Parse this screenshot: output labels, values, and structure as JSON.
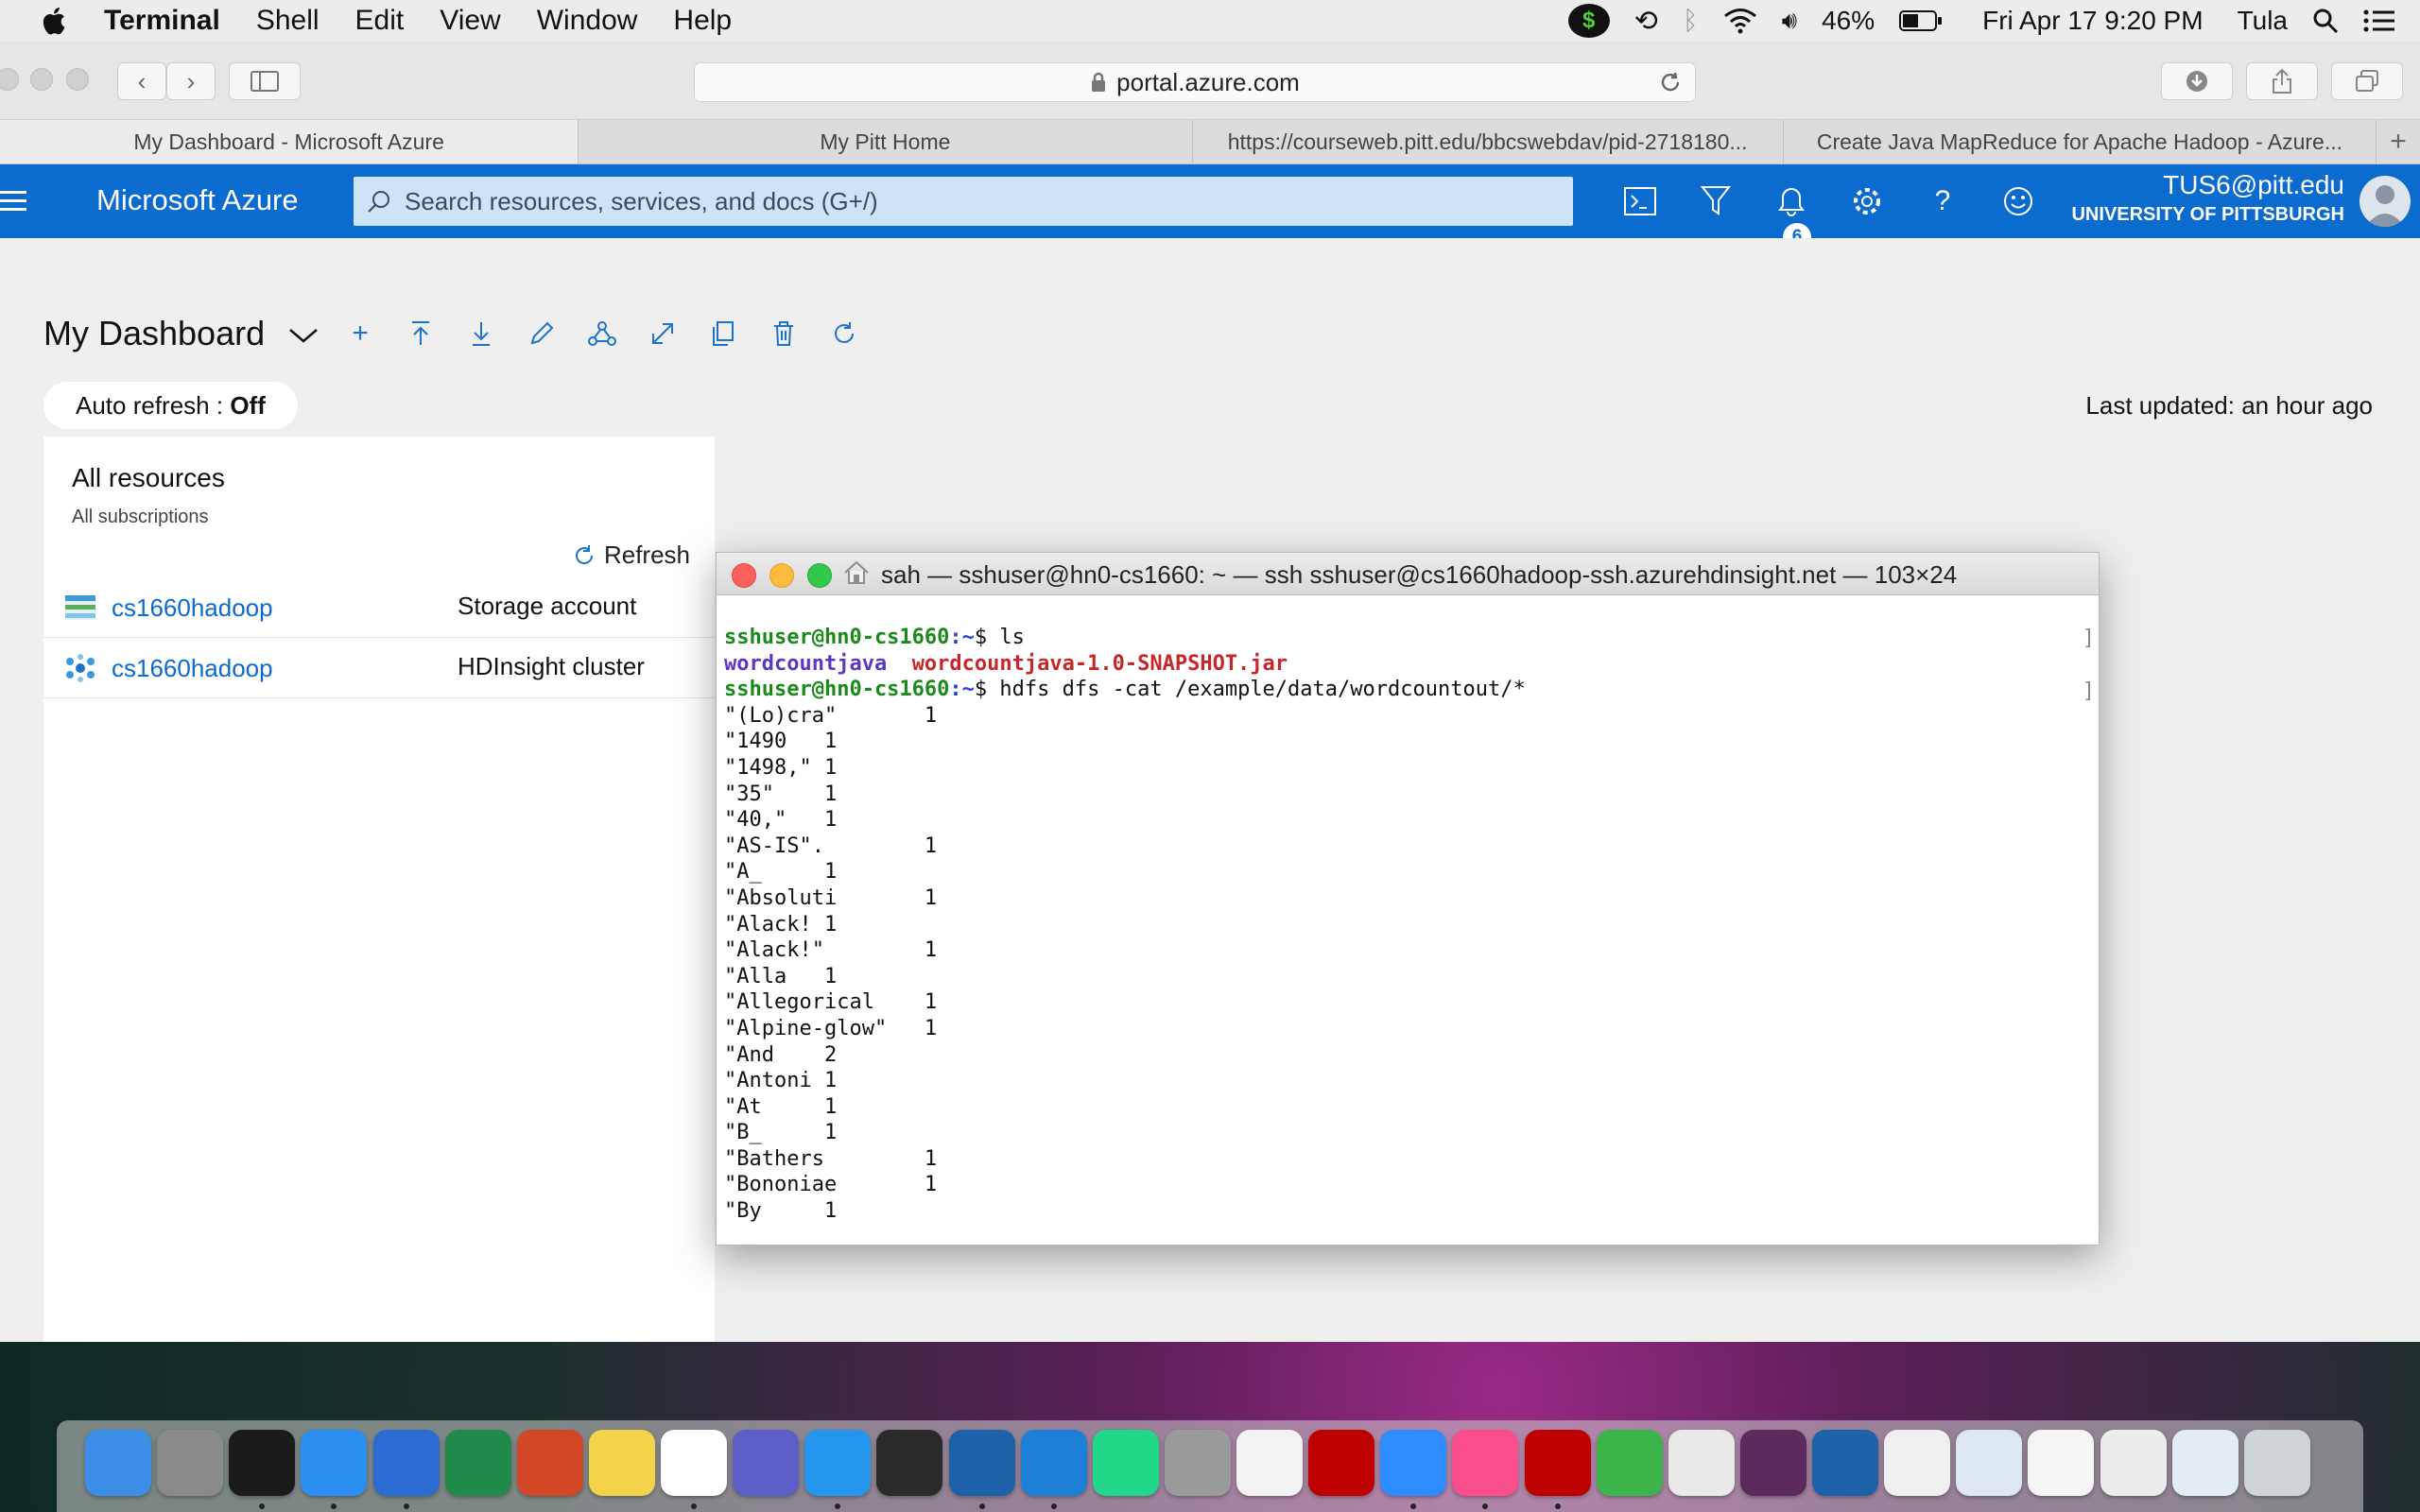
{
  "menubar": {
    "app": "Terminal",
    "items": [
      "Shell",
      "Edit",
      "View",
      "Window",
      "Help"
    ],
    "battery": "46%",
    "datetime": "Fri Apr 17  9:20 PM",
    "user": "Tula"
  },
  "browser": {
    "url": "portal.azure.com",
    "tabs": [
      "My Dashboard - Microsoft Azure",
      "My Pitt Home",
      "https://courseweb.pitt.edu/bbcswebdav/pid-2718180...",
      "Create Java MapReduce for Apache Hadoop - Azure..."
    ]
  },
  "azure": {
    "brand": "Microsoft Azure",
    "search_placeholder": "Search resources, services, and docs (G+/)",
    "notifications": "6",
    "account_email": "TUS6@pitt.edu",
    "account_org": "UNIVERSITY OF PITTSBURGH"
  },
  "dashboard": {
    "title": "My Dashboard",
    "auto_refresh_label": "Auto refresh : ",
    "auto_refresh_value": "Off",
    "last_updated": "Last updated: an hour ago",
    "tile": {
      "title": "All resources",
      "subtitle": "All subscriptions",
      "refresh": "Refresh",
      "rows": [
        {
          "name": "cs1660hadoop",
          "type": "Storage account"
        },
        {
          "name": "cs1660hadoop",
          "type": "HDInsight cluster"
        }
      ]
    }
  },
  "terminal": {
    "title": "sah — sshuser@hn0-cs1660: ~ — ssh sshuser@cs1660hadoop-ssh.azurehdinsight.net — 103×24",
    "prompt_user": "sshuser@hn0-cs1660",
    "prompt_path": ":~",
    "cmd1": "$ ls",
    "ls_dir": "wordcountjava",
    "ls_jar": "wordcountjava-1.0-SNAPSHOT.jar",
    "cmd2": "$ hdfs dfs -cat /example/data/wordcountout/*",
    "output": [
      "\"(Lo)cra\"\t1",
      "\"1490\t1",
      "\"1498,\"\t1",
      "\"35\"\t1",
      "\"40,\"\t1",
      "\"AS-IS\".\t1",
      "\"A_\t1",
      "\"Absoluti\t1",
      "\"Alack!\t1",
      "\"Alack!\"\t1",
      "\"Alla\t1",
      "\"Allegorical\t1",
      "\"Alpine-glow\"\t1",
      "\"And\t2",
      "\"Antoni\t1",
      "\"At\t1",
      "\"B_\t1",
      "\"Bathers\t1",
      "\"Bononiae\t1",
      "\"By\t1"
    ]
  }
}
